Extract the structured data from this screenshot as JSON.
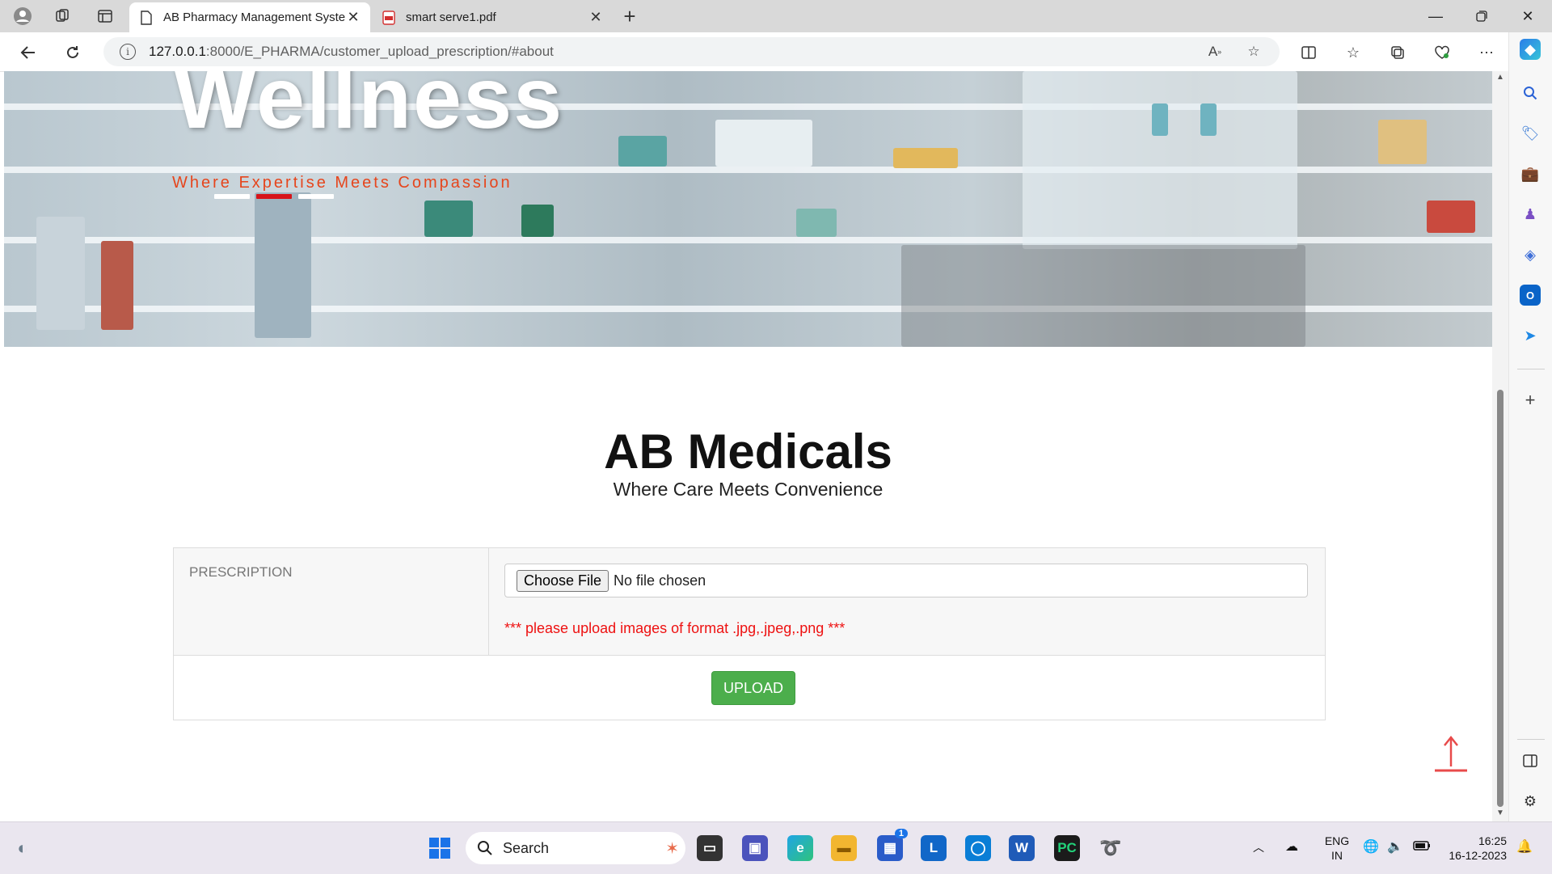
{
  "browser": {
    "tabs": [
      {
        "label": "AB Pharmacy Management Syste",
        "active": true
      },
      {
        "label": "smart serve1.pdf",
        "active": false
      }
    ],
    "url_host": "127.0.0.1",
    "url_path": ":8000/E_PHARMA/customer_upload_prescription/#about"
  },
  "hero": {
    "title": "Wellness",
    "tagline": "Where Expertise Meets Compassion"
  },
  "brand": {
    "title": "AB Medicals",
    "subtitle": "Where Care Meets Convenience"
  },
  "form": {
    "label": "PRESCRIPTION",
    "choose_file_label": "Choose File",
    "file_status": "No file chosen",
    "hint": "*** please upload images of format .jpg,.jpeg,.png ***",
    "upload_label": "UPLOAD"
  },
  "colors": {
    "tagline": "#e6451c",
    "hint": "#ee1111",
    "upload": "#4cae4c",
    "scroll_arrow": "#e84a4a"
  },
  "taskbar": {
    "search_placeholder": "Search",
    "store_badge": "1",
    "lang_primary": "ENG",
    "lang_secondary": "IN",
    "time": "16:25",
    "date": "16-12-2023"
  }
}
